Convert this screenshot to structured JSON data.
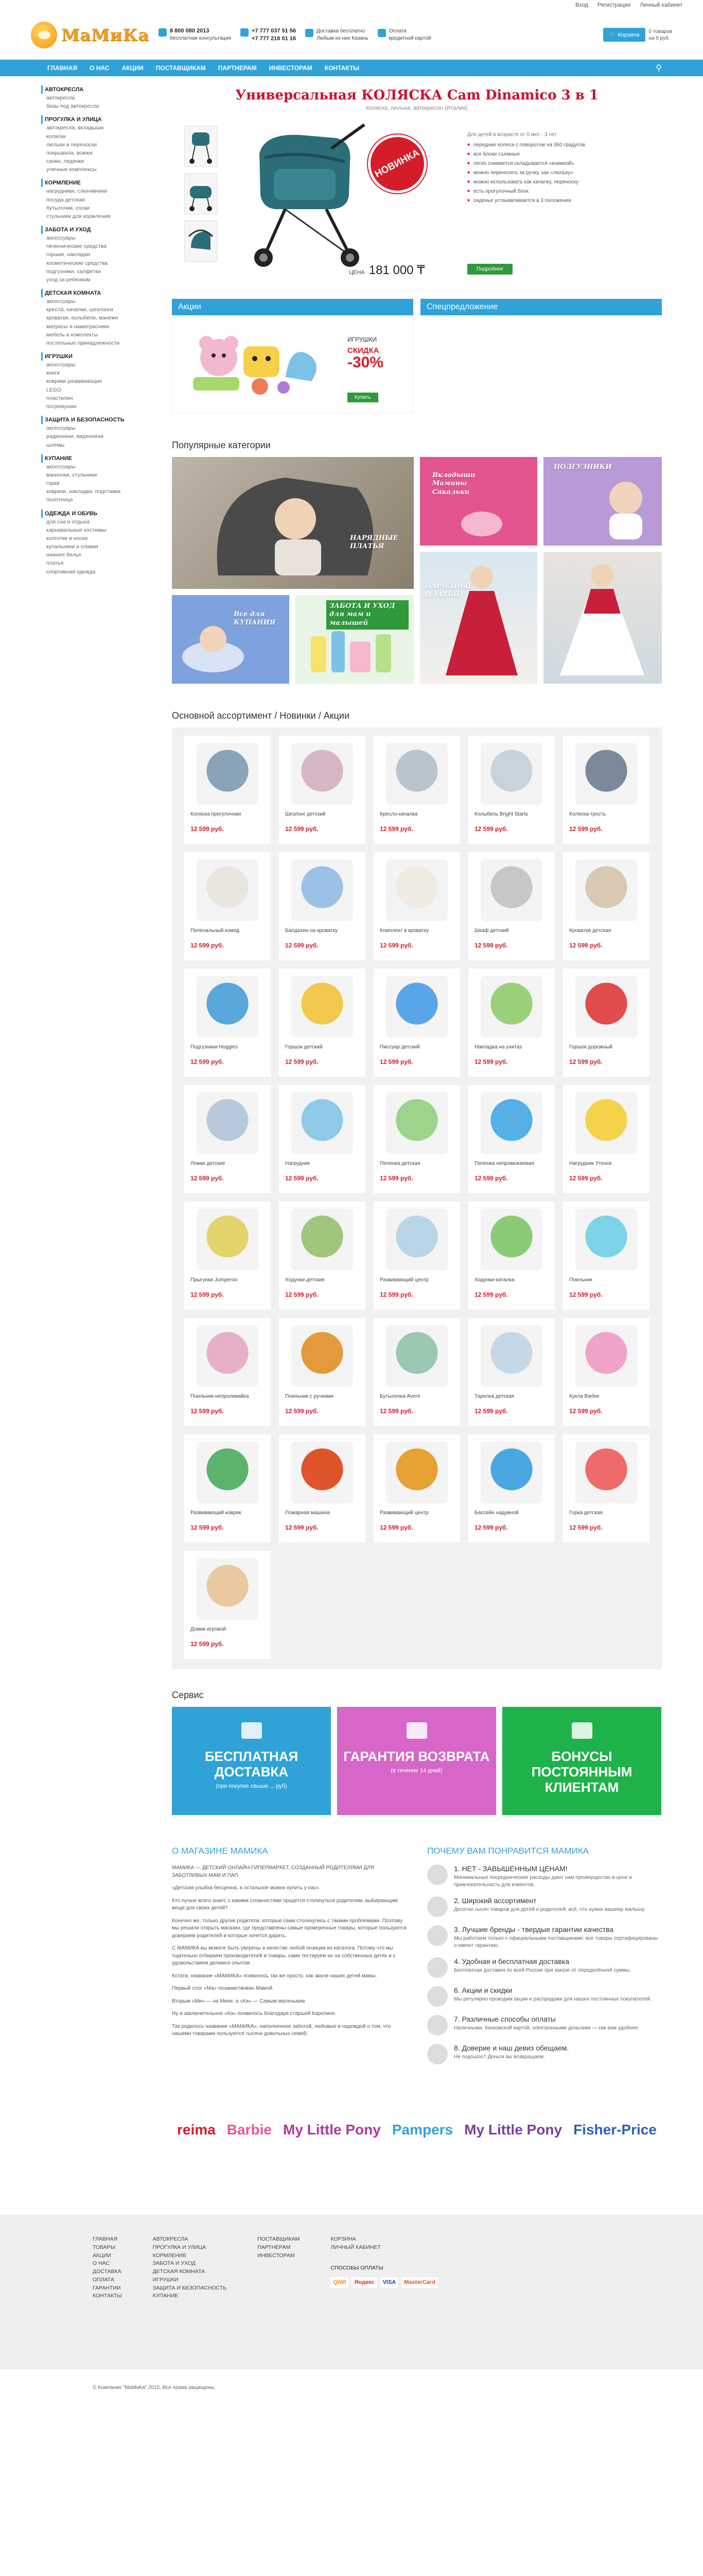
{
  "topbar": {
    "login": "Вход",
    "register": "Регистрация",
    "cabinet": "Личный кабинет"
  },
  "header": {
    "logo": "МаМиКа",
    "phone1": "8 800 080 2013",
    "phone1_note": "бесплатная консультация",
    "phone2": "+7 777 037 51 56",
    "phone3": "+7 777 216 01 16",
    "delivery": "Доставка бесплатно",
    "delivery_note": "Любым из них Казань",
    "payment": "Оплата",
    "payment_note": "кредитной картой",
    "cart": "Корзина",
    "cart_count": "0 товаров",
    "cart_sum": "на 0 руб."
  },
  "nav": [
    "ГЛАВНАЯ",
    "О НАС",
    "АКЦИИ",
    "ПОСТАВЩИКАМ",
    "ПАРТНЕРАМ",
    "ИНВЕСТОРАМ",
    "КОНТАКТЫ"
  ],
  "categories": [
    {
      "title": "АВТОКРЕСЛА",
      "items": [
        "автокресла",
        "базы под автокресла"
      ]
    },
    {
      "title": "ПРОГУЛКА И УЛИЦА",
      "items": [
        "автокресла, вкладыши",
        "коляски",
        "люльки и переноски",
        "покрывала, вожжи",
        "санки, ледянки",
        "уличные комплексы"
      ]
    },
    {
      "title": "КОРМЛЕНИЕ",
      "items": [
        "нагрудники, слюнявчики",
        "посуда детская",
        "бутылочки, соски",
        "стульчики для кормления"
      ]
    },
    {
      "title": "ЗАБОТА И УХОД",
      "items": [
        "аксессуары",
        "гигиенические средства",
        "горшки, накладки",
        "косметические средства",
        "подгузники, салфетки",
        "уход за ребенком"
      ]
    },
    {
      "title": "ДЕТСКАЯ КОМНАТА",
      "items": [
        "аксессуары",
        "кресла, качалки, шезлонги",
        "кроватки, колыбели, манежи",
        "матрасы и наматрасники",
        "мебель и комплекты",
        "постельные принадлежности"
      ]
    },
    {
      "title": "ИГРУШКИ",
      "items": [
        "аксессуары",
        "книги",
        "коврики развивающие",
        "LEGO",
        "пластилин",
        "погремушки"
      ]
    },
    {
      "title": "ЗАЩИТА И БЕЗОПАСНОСТЬ",
      "items": [
        "аксессуары",
        "радионяни, видеоняни",
        "шлемы"
      ]
    },
    {
      "title": "КУПАНИЕ",
      "items": [
        "аксессуары",
        "ванночки, стульчики",
        "горки",
        "коврики, накладки, подставки",
        "полотенца"
      ]
    },
    {
      "title": "ОДЕЖДА И ОБУВЬ",
      "items": [
        "для сна и отдыха",
        "карнавальные костюмы",
        "колготки и носки",
        "купальники и плавки",
        "нижнее белье",
        "платья",
        "спортивная одежда"
      ]
    }
  ],
  "hero": {
    "title": "Универсальная КОЛЯСКА Cam Dinamico 3 в 1",
    "subtitle": "Коляска, люлька, автокресло (Италия)",
    "badge": "НОВИНКА",
    "lead": "Для детей в возрасте от 0 мес - 3 лет",
    "features": [
      "передние колеса с поворотом на 360 градусов",
      "все блоки съемные",
      "легко снимается складывается «книжкой»",
      "можно переносить за ручку, как «люльку»",
      "можно использовать как качалку, переноску",
      "есть прогулочный блок",
      "сиденье устанавливается в 3 положения"
    ],
    "price_label": "ЦЕНА",
    "price": "181 000 ₸",
    "button": "Подробнее"
  },
  "promo": {
    "actions_title": "Акции",
    "special_title": "Спецпредложение",
    "toys": "ИГРУШКИ",
    "sale": "СКИДКА",
    "pct": "-30%",
    "buy": "Купить"
  },
  "popular_title": "Популярные категории",
  "tiles": {
    "t1": "НАРЯДНЫЕ ПЛАТЬЯ",
    "t2": "Вкладыши Мамины Сакальки",
    "t3": "ПОДГУЗНИКИ",
    "t4": "Все для КУПАНИЯ",
    "t5": "ЗАБОТА И УХОД для мам и малышей",
    "t6": "НАРЯДНЫЕ ПЛАТЬЯ"
  },
  "assortment_title": "Основной ассортимент / Новинки / Акции",
  "products": [
    {
      "name": "Коляска прогулочная",
      "price": "12 599 руб."
    },
    {
      "name": "Шезлонг детский",
      "price": "12 599 руб."
    },
    {
      "name": "Кресло-качалка",
      "price": "12 599 руб."
    },
    {
      "name": "Колыбель Bright Starts",
      "price": "12 599 руб."
    },
    {
      "name": "Коляска-трость",
      "price": "12 599 руб."
    },
    {
      "name": "Пеленальный комод",
      "price": "12 599 руб."
    },
    {
      "name": "Балдахин на кроватку",
      "price": "12 599 руб."
    },
    {
      "name": "Комплект в кроватку",
      "price": "12 599 руб."
    },
    {
      "name": "Шкаф детский",
      "price": "12 599 руб."
    },
    {
      "name": "Кроватка детская",
      "price": "12 599 руб."
    },
    {
      "name": "Подгузники Huggies",
      "price": "12 599 руб."
    },
    {
      "name": "Горшок детский",
      "price": "12 599 руб."
    },
    {
      "name": "Писсуар детский",
      "price": "12 599 руб."
    },
    {
      "name": "Накладка на унитаз",
      "price": "12 599 руб."
    },
    {
      "name": "Горшок дорожный",
      "price": "12 599 руб."
    },
    {
      "name": "Ложки детские",
      "price": "12 599 руб."
    },
    {
      "name": "Нагрудник",
      "price": "12 599 руб."
    },
    {
      "name": "Пеленка детская",
      "price": "12 599 руб."
    },
    {
      "name": "Пеленка непромокаемая",
      "price": "12 599 руб."
    },
    {
      "name": "Нагрудник Утенок",
      "price": "12 599 руб."
    },
    {
      "name": "Прыгунки Jumperoo",
      "price": "12 599 руб."
    },
    {
      "name": "Ходунки детские",
      "price": "12 599 руб."
    },
    {
      "name": "Развивающий центр",
      "price": "12 599 руб."
    },
    {
      "name": "Ходунки-каталка",
      "price": "12 599 руб."
    },
    {
      "name": "Поильник",
      "price": "12 599 руб."
    },
    {
      "name": "Поильник-непроливайка",
      "price": "12 599 руб."
    },
    {
      "name": "Поильник с ручками",
      "price": "12 599 руб."
    },
    {
      "name": "Бутылочка Avent",
      "price": "12 599 руб."
    },
    {
      "name": "Тарелка детская",
      "price": "12 599 руб."
    },
    {
      "name": "Кукла Barbie",
      "price": "12 599 руб."
    },
    {
      "name": "Развивающий коврик",
      "price": "12 599 руб."
    },
    {
      "name": "Пожарная машина",
      "price": "12 599 руб."
    },
    {
      "name": "Развивающий центр",
      "price": "12 599 руб."
    },
    {
      "name": "Бассейн надувной",
      "price": "12 599 руб."
    },
    {
      "name": "Горка детская",
      "price": "12 599 руб."
    },
    {
      "name": "Домик игровой",
      "price": "12 599 руб."
    }
  ],
  "service_title": "Сервис",
  "service": [
    {
      "big": "БЕСПЛАТНАЯ ДОСТАВКА",
      "small": "(при покупке свыше ... руб)",
      "color": "#2fa3d8"
    },
    {
      "big": "ГАРАНТИЯ ВОЗВРАТА",
      "small": "(в течение 14 дней)",
      "color": "#d766c8"
    },
    {
      "big": "БОНУСЫ ПОСТОЯННЫМ КЛИЕНТАМ",
      "small": "",
      "color": "#1fb24a"
    }
  ],
  "about": {
    "title": "О МАГАЗИНЕ МАМИКА",
    "paragraphs": [
      "МАМИКА — ДЕТСКИЙ ОНЛАЙН-ГИПЕРМАРКЕТ, СОЗДАННЫЙ РОДИТЕЛЯМИ ДЛЯ ЗАБОТЛИВЫХ МАМ И ПАП",
      "«Детская улыбка бесценна, а остальное можно купить у нас»",
      "Кто лучше всего знает, с какими сложностями придется столкнуться родителям, выбирающим вещи для своих детей?",
      "Конечно же, только другие родители, которые сами столкнулись с такими проблемами. Поэтому мы решили открыть магазин, где представлены самые проверенные товары, которые пользуются доверием родителей и которые хочется дарить.",
      "С МАМИКА вы можете быть уверены в качестве любой позиции из каталога. Потому что мы тщательно отбираем производителей и товары, сами тестируем их на собственных детях и с удовольствием делимся опытом.",
      "Кстати, название «МАМИКА» появилось так же просто, как звали наших детей мамы.",
      "Первый слог «Ма» позаимствован Мамой.",
      "Вторым «Ми» — на Мине, а «Ка» — Самым маленьким.",
      "Ну а заключительное «Ка» появилось благодаря старшей Каролине.",
      "Так родилось название «МАМИКА», наполненное заботой, любовью и надеждой о том, что нашими товарами пользуются тысячи довольных семей."
    ]
  },
  "why": {
    "title": "ПОЧЕМУ ВАМ ПОНРАВИТСЯ МАМИКА",
    "items": [
      {
        "h": "1. НЕТ - ЗАВЫШЕННЫМ ЦЕНАМ!",
        "t": "Минимальные посреднические расходы дают нам преимущество в цене и привлекательность для клиентов."
      },
      {
        "h": "2. Широкий ассортимент",
        "t": "Десятки тысяч товаров для детей и родителей: всё, что нужно вашему малышу."
      },
      {
        "h": "3. Лучшие бренды - твердые гарантии качества",
        "t": "Мы работаем только с официальными поставщиками: все товары сертифицированы и имеют гарантию."
      },
      {
        "h": "4. Удобная и бесплатная доставка",
        "t": "Бесплатная доставка по всей России при заказе от определённой суммы."
      },
      {
        "h": "6. Акции и скидки",
        "t": "Мы регулярно проводим акции и распродажи для наших постоянных покупателей."
      },
      {
        "h": "7. Различные способы оплаты",
        "t": "Наличными, банковской картой, электронными деньгами — как вам удобнее."
      },
      {
        "h": "8. Доверие и наш девиз обещаем.",
        "t": "Не подошло? Деньги вы возвращаем."
      }
    ]
  },
  "brands": [
    {
      "name": "reima",
      "color": "#d51d2a"
    },
    {
      "name": "Barbie",
      "color": "#e5559c"
    },
    {
      "name": "My Little Pony",
      "color": "#b0379c"
    },
    {
      "name": "Pampers",
      "color": "#2fa3d8"
    },
    {
      "name": "My Little Pony",
      "color": "#7b3fa0"
    },
    {
      "name": "Fisher-Price",
      "color": "#2f5fb8"
    }
  ],
  "footer": {
    "col1": [
      "ГЛАВНАЯ",
      "ТОВАРЫ",
      "АКЦИИ",
      "О НАС",
      "ДОСТАВКА",
      "ОПЛАТА",
      "ГАРАНТИИ",
      "КОНТАКТЫ"
    ],
    "col2": [
      "АВТОКРЕСЛА",
      "ПРОГУЛКА И УЛИЦА",
      "КОРМЛЕНИЕ",
      "ЗАБОТА И УХОД",
      "ДЕТСКАЯ КОМНАТА",
      "ИГРУШКИ",
      "ЗАЩИТА И БЕЗОПАСНОСТЬ",
      "КУПАНИЕ"
    ],
    "col3": [
      "ПОСТАВЩИКАМ",
      "ПАРТНЕРАМ",
      "ИНВЕСТОРАМ"
    ],
    "col4": [
      "КОРЗИНА",
      "ЛИЧНЫЙ КАБИНЕТ"
    ],
    "pay_title": "СПОСОБЫ ОПЛАТЫ",
    "pay": [
      "QIWI",
      "Яндекс",
      "VISA",
      "MasterCard"
    ],
    "copyright": "© Компания \"МаМиКа\" 2015, Все права защищены."
  }
}
